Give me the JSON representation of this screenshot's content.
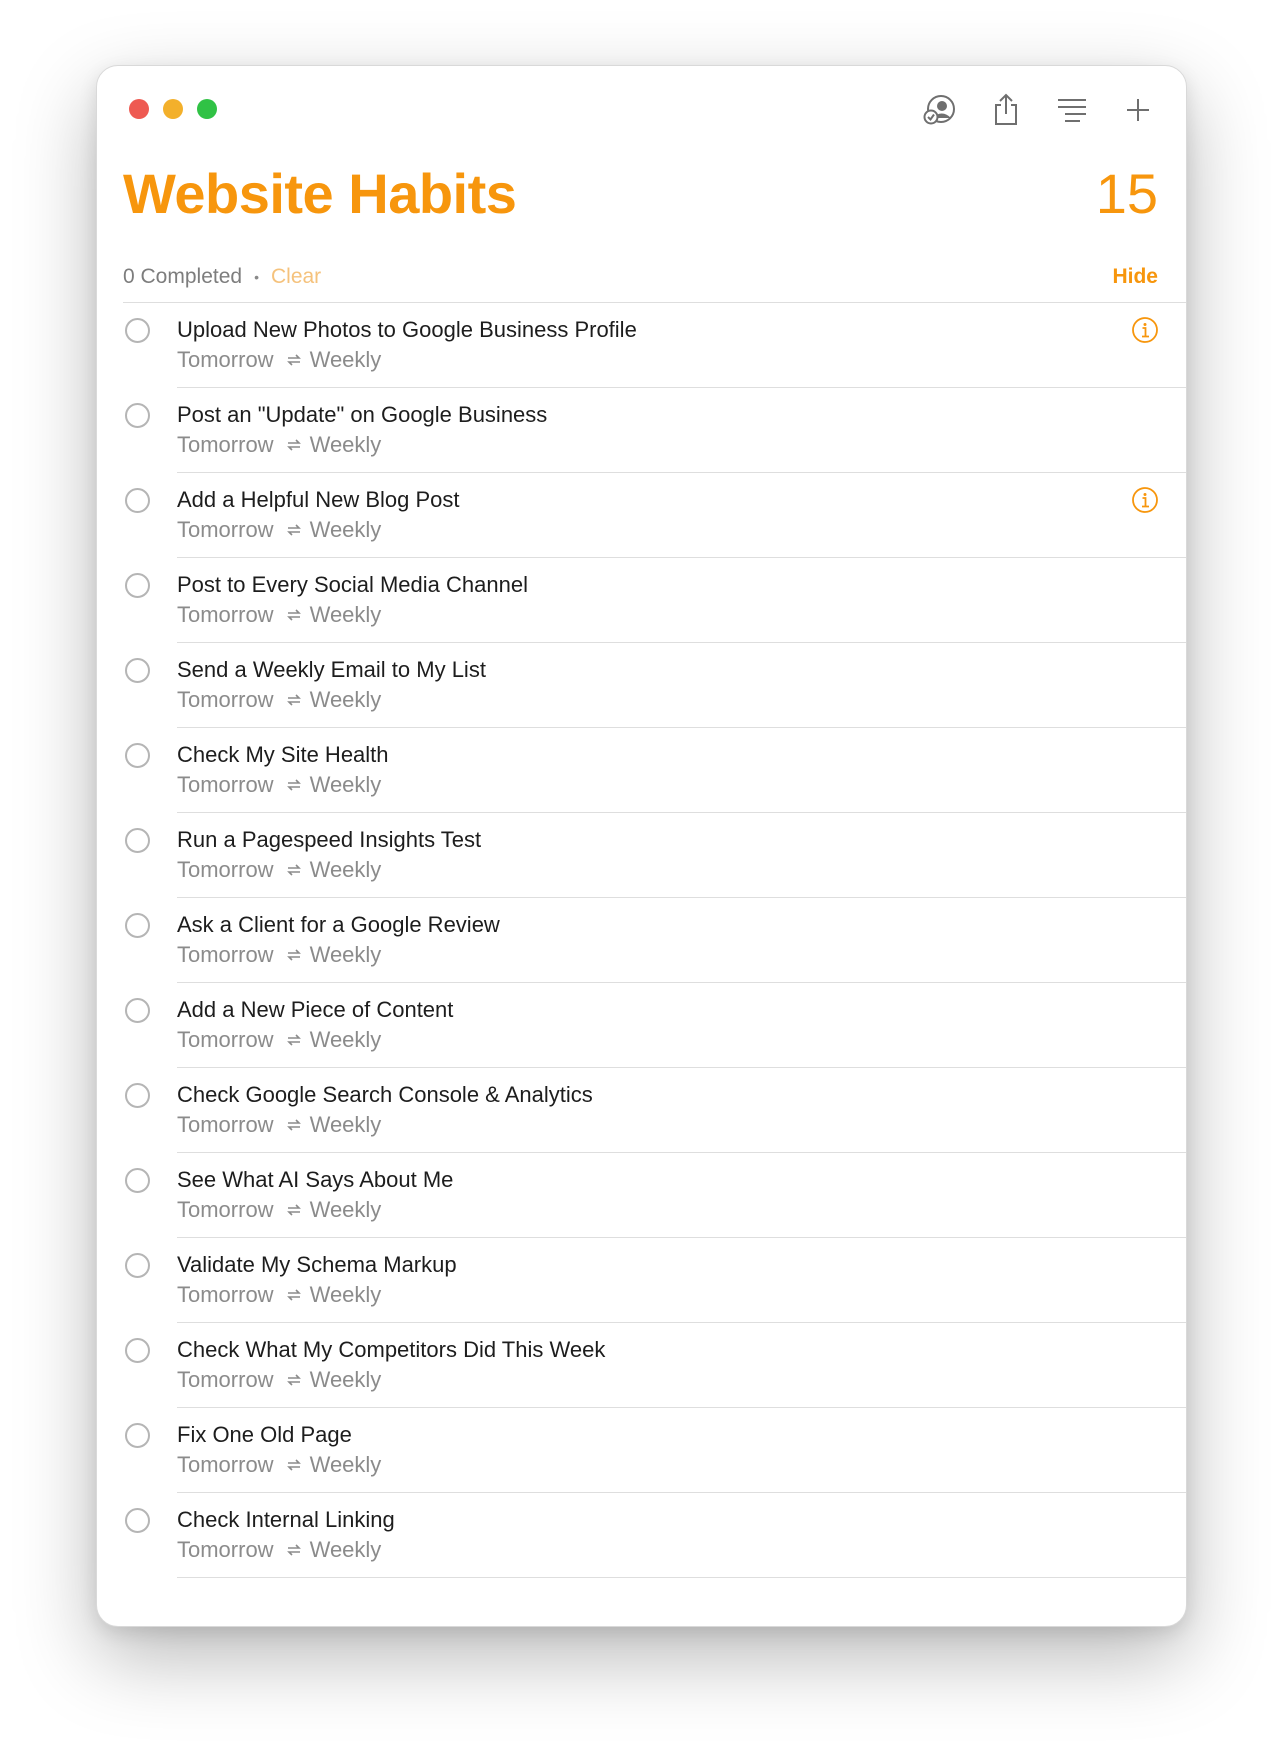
{
  "window": {
    "title": "Website Habits",
    "count": "15"
  },
  "toolbar": {
    "icons": [
      "shared-person-icon",
      "share-icon",
      "list-format-icon",
      "add-icon"
    ]
  },
  "summary": {
    "completed": "0 Completed",
    "separator": "•",
    "clear": "Clear",
    "hide": "Hide"
  },
  "colors": {
    "accent": "#f7960d",
    "clear": "#f5c27c",
    "text": "#1d1d1d",
    "secondary": "#8b8b8b"
  },
  "tasks": [
    {
      "title": "Upload New Photos to Google Business Profile",
      "due": "Tomorrow",
      "repeat": "Weekly",
      "info": true
    },
    {
      "title": "Post an \"Update\" on Google Business",
      "due": "Tomorrow",
      "repeat": "Weekly",
      "info": false
    },
    {
      "title": "Add a Helpful New Blog Post",
      "due": "Tomorrow",
      "repeat": "Weekly",
      "info": true
    },
    {
      "title": "Post to Every Social Media Channel",
      "due": "Tomorrow",
      "repeat": "Weekly",
      "info": false
    },
    {
      "title": "Send a Weekly Email to My List",
      "due": "Tomorrow",
      "repeat": "Weekly",
      "info": false
    },
    {
      "title": "Check My Site Health",
      "due": "Tomorrow",
      "repeat": "Weekly",
      "info": false
    },
    {
      "title": "Run a Pagespeed Insights Test",
      "due": "Tomorrow",
      "repeat": "Weekly",
      "info": false
    },
    {
      "title": "Ask a Client for a Google Review",
      "due": "Tomorrow",
      "repeat": "Weekly",
      "info": false
    },
    {
      "title": "Add a New Piece of Content",
      "due": "Tomorrow",
      "repeat": "Weekly",
      "info": false
    },
    {
      "title": "Check Google Search Console & Analytics",
      "due": "Tomorrow",
      "repeat": "Weekly",
      "info": false
    },
    {
      "title": "See What AI Says About Me",
      "due": "Tomorrow",
      "repeat": "Weekly",
      "info": false
    },
    {
      "title": "Validate My Schema Markup",
      "due": "Tomorrow",
      "repeat": "Weekly",
      "info": false
    },
    {
      "title": "Check What My Competitors Did This Week",
      "due": "Tomorrow",
      "repeat": "Weekly",
      "info": false
    },
    {
      "title": "Fix One Old Page",
      "due": "Tomorrow",
      "repeat": "Weekly",
      "info": false
    },
    {
      "title": "Check Internal Linking",
      "due": "Tomorrow",
      "repeat": "Weekly",
      "info": false
    }
  ]
}
